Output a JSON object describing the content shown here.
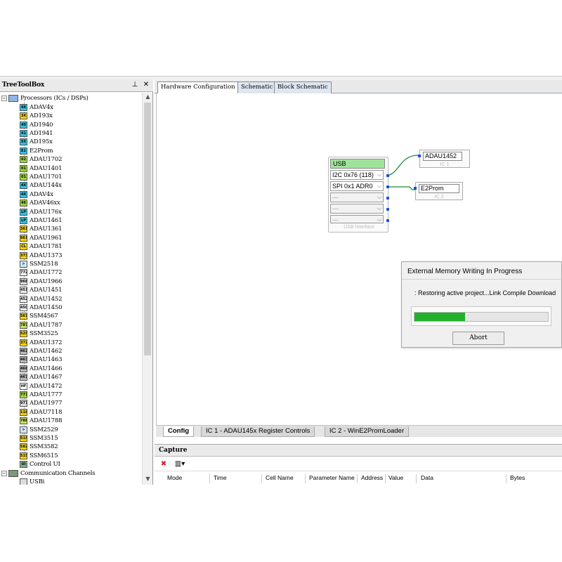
{
  "toolbox": {
    "title": "TreeToolBox",
    "pin_glyph": "⊥",
    "close_glyph": "✕",
    "processors_label": "Processors (ICs / DSPs)",
    "items": [
      {
        "label": "ADAV4x",
        "icon": "4X",
        "color": "#33c0e0"
      },
      {
        "label": "AD193x",
        "icon": "3X",
        "color": "#f2d21a"
      },
      {
        "label": "AD1940",
        "icon": "40",
        "color": "#33c0e0"
      },
      {
        "label": "AD1941",
        "icon": "41",
        "color": "#33c0e0"
      },
      {
        "label": "AD195x",
        "icon": "5X",
        "color": "#33c0e0"
      },
      {
        "label": "E2Prom",
        "icon": "E2",
        "color": "#33c0e0"
      },
      {
        "label": "ADAU1702",
        "icon": "02",
        "color": "#9cd63a"
      },
      {
        "label": "ADAU1401",
        "icon": "01",
        "color": "#9cd63a"
      },
      {
        "label": "ADAU1701",
        "icon": "01",
        "color": "#9cd63a"
      },
      {
        "label": "ADAU144x",
        "icon": "4X",
        "color": "#33c0e0"
      },
      {
        "label": "ADAV4x",
        "icon": "4X",
        "color": "#33c0e0"
      },
      {
        "label": "ADAV46xx",
        "icon": "46",
        "color": "#9cd63a"
      },
      {
        "label": "ADAU176x",
        "icon": "LP",
        "color": "#33c0e0"
      },
      {
        "label": "ADAU1461",
        "icon": "LP",
        "color": "#33c0e0"
      },
      {
        "label": "ADAU1361",
        "icon": "361",
        "color": "#f2d21a"
      },
      {
        "label": "ADAU1961",
        "icon": "961",
        "color": "#f2d21a"
      },
      {
        "label": "ADAU1781",
        "icon": "CL",
        "color": "#f2d21a"
      },
      {
        "label": "ADAU1373",
        "icon": "373",
        "color": "#f2d21a"
      },
      {
        "label": "SSM2518",
        "icon": ">",
        "color": "#cfe8f8"
      },
      {
        "label": "ADAU1772",
        "icon": "772",
        "color": "#f0f0f0"
      },
      {
        "label": "ADAU1966",
        "icon": "966",
        "color": "#dddddd"
      },
      {
        "label": "ADAU1451",
        "icon": "451",
        "color": "#f0f0f0"
      },
      {
        "label": "ADAU1452",
        "icon": "452",
        "color": "#f0f0f0"
      },
      {
        "label": "ADAU1450",
        "icon": "450",
        "color": "#f0f0f0"
      },
      {
        "label": "SSM4567",
        "icon": "567",
        "color": "#f2d21a"
      },
      {
        "label": "ADAU1787",
        "icon": "787",
        "color": "#c8e060"
      },
      {
        "label": "SSM3525",
        "icon": "525",
        "color": "#f2d21a"
      },
      {
        "label": "ADAU1372",
        "icon": "372",
        "color": "#f2d21a"
      },
      {
        "label": "ADAU1462",
        "icon": "462",
        "color": "#bbbbbb"
      },
      {
        "label": "ADAU1463",
        "icon": "463",
        "color": "#bbbbbb"
      },
      {
        "label": "ADAU1466",
        "icon": "466",
        "color": "#bbbbbb"
      },
      {
        "label": "ADAU1467",
        "icon": "467",
        "color": "#bbbbbb"
      },
      {
        "label": "ADAU1472",
        "icon": "HF",
        "color": "#ffffff"
      },
      {
        "label": "ADAU1777",
        "icon": "777",
        "color": "#9cd63a"
      },
      {
        "label": "ADAU1977",
        "icon": "977",
        "color": "#dddddd"
      },
      {
        "label": "ADAU7118",
        "icon": "118",
        "color": "#f2d21a"
      },
      {
        "label": "ADAU1788",
        "icon": "788",
        "color": "#c8e060"
      },
      {
        "label": "SSM2529",
        "icon": ">",
        "color": "#cfe8f8"
      },
      {
        "label": "SSM3515",
        "icon": "515",
        "color": "#f2d21a"
      },
      {
        "label": "SSM3582",
        "icon": "582",
        "color": "#f2d21a"
      },
      {
        "label": "SSM6515",
        "icon": "515",
        "color": "#f2d21a"
      },
      {
        "label": "Control UI",
        "icon": "UI",
        "color": "#88aa88"
      }
    ],
    "comm_label": "Communication Channels",
    "comm_child": "USBi"
  },
  "tabs": [
    {
      "label": "Hardware Configuration",
      "active": true
    },
    {
      "label": "Schematic",
      "active": false
    },
    {
      "label": "Block Schematic",
      "active": false
    }
  ],
  "canvas": {
    "usb": {
      "header": "USB",
      "ports": [
        "I2C 0x76 (118)",
        "SPI 0x1 ADR0",
        "---",
        "---",
        "---",
        "---"
      ],
      "caption": "USB Interface"
    },
    "ic1": {
      "name": "ADAU1452",
      "caption": "IC 1"
    },
    "ic2": {
      "name": "E2Prom",
      "caption": "IC 2"
    },
    "wire_color": "#1a8a3a"
  },
  "dialog": {
    "title": "External Memory Writing In Progress",
    "message": ": Restoring active project...Link Compile Download",
    "progress": 0.38,
    "abort_label": "Abort",
    "bar_color": "#22b02c"
  },
  "bottom_tabs": [
    {
      "label": "Config",
      "active": true
    },
    {
      "label": "IC 1 - ADAU145x Register Controls",
      "active": false
    },
    {
      "label": "IC 2 - WinE2PromLoader",
      "active": false
    }
  ],
  "capture": {
    "title": "Capture",
    "columns": [
      "Mode",
      "Time",
      "Cell Name",
      "Parameter Name",
      "Address",
      "Value",
      "Data",
      "Bytes"
    ]
  }
}
